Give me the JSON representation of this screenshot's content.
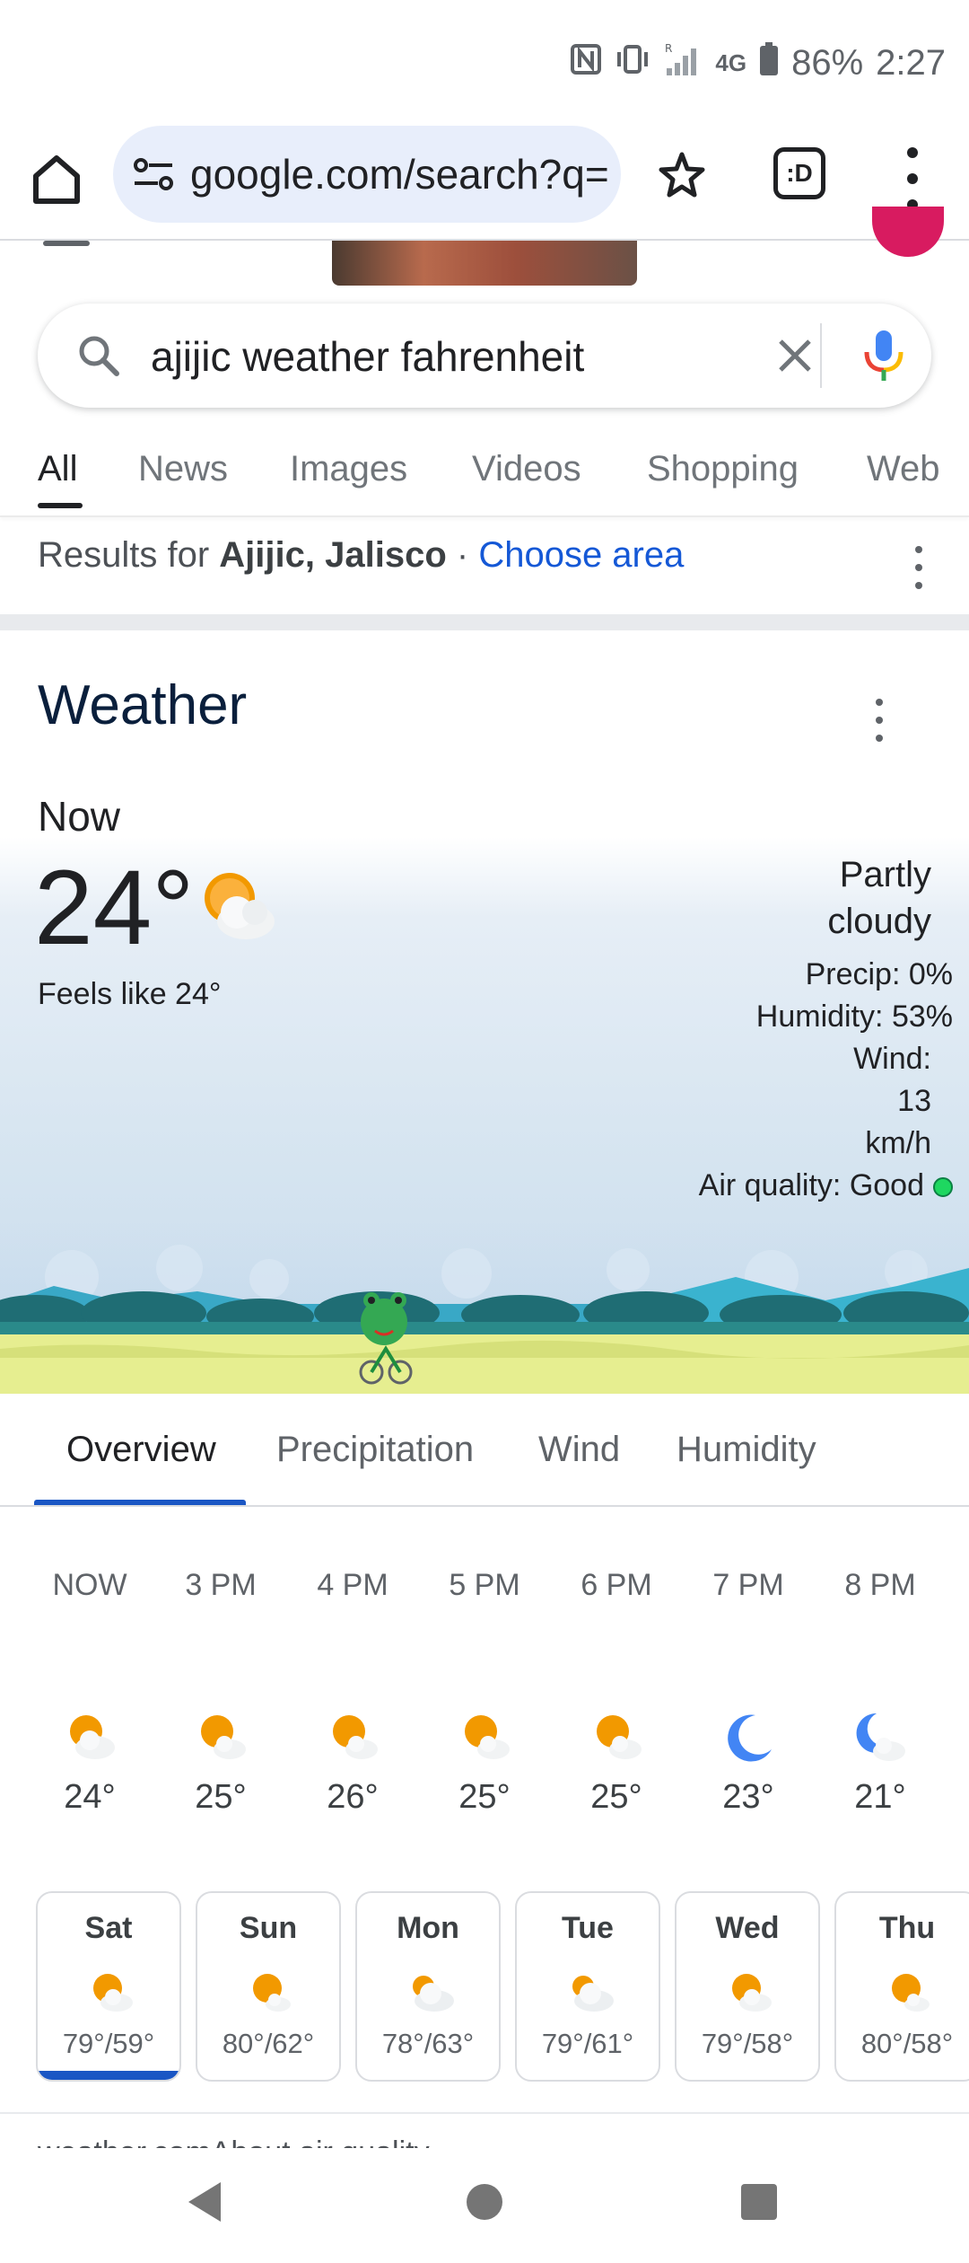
{
  "status_bar": {
    "battery": "86%",
    "time": "2:27",
    "network": "4G",
    "icons": [
      "nfc-icon",
      "vibrate-icon",
      "signal-icon",
      "battery-icon"
    ]
  },
  "browser": {
    "url": "google.com/search?q=",
    "tab_count": ":D",
    "icons": [
      "home-icon",
      "site-settings-icon",
      "star-icon",
      "tabs-icon",
      "more-vert-icon"
    ]
  },
  "search": {
    "query": "ajijic weather fahrenheit"
  },
  "search_tabs": [
    "All",
    "News",
    "Images",
    "Videos",
    "Shopping",
    "Web"
  ],
  "results_for": {
    "prefix": "Results for ",
    "place": "Ajijic, Jalisco",
    "separator": " · ",
    "link": "Choose area"
  },
  "weather": {
    "title": "Weather",
    "now_label": "Now",
    "temperature": "24°",
    "feels_like": "Feels like 24°",
    "condition_line1": "Partly",
    "condition_line2": "cloudy",
    "precip": "Precip: 0%",
    "humidity": "Humidity: 53%",
    "wind_label": "Wind:",
    "wind_value": "13",
    "wind_unit": "km/h",
    "air_quality": "Air quality: Good",
    "air_quality_color": "#1ed760"
  },
  "weather_tabs": [
    "Overview",
    "Precipitation",
    "Wind",
    "Humidity"
  ],
  "hourly": [
    {
      "time": "NOW",
      "temp": "24°",
      "icon": "partly-cloudy-icon"
    },
    {
      "time": "3 PM",
      "temp": "25°",
      "icon": "partly-cloudy-icon"
    },
    {
      "time": "4 PM",
      "temp": "26°",
      "icon": "partly-cloudy-icon"
    },
    {
      "time": "5 PM",
      "temp": "25°",
      "icon": "partly-cloudy-icon"
    },
    {
      "time": "6 PM",
      "temp": "25°",
      "icon": "partly-cloudy-icon"
    },
    {
      "time": "7 PM",
      "temp": "23°",
      "icon": "moon-icon"
    },
    {
      "time": "8 PM",
      "temp": "21°",
      "icon": "partly-cloudy-night-icon"
    }
  ],
  "daily": [
    {
      "day": "Sat",
      "range": "79°/59°",
      "icon": "partly-cloudy-icon",
      "selected": true
    },
    {
      "day": "Sun",
      "range": "80°/62°",
      "icon": "partly-cloudy-icon"
    },
    {
      "day": "Mon",
      "range": "78°/63°",
      "icon": "mostly-cloudy-icon"
    },
    {
      "day": "Tue",
      "range": "79°/61°",
      "icon": "mostly-cloudy-icon"
    },
    {
      "day": "Wed",
      "range": "79°/58°",
      "icon": "partly-cloudy-icon"
    },
    {
      "day": "Thu",
      "range": "80°/58°",
      "icon": "partly-cloudy-icon"
    }
  ],
  "footer": {
    "source": "weather.com",
    "about": "About air quality"
  },
  "colors": {
    "accent": "#1a56c4",
    "link": "#1558d6",
    "sun": "#f29900",
    "moon": "#4285f4"
  }
}
